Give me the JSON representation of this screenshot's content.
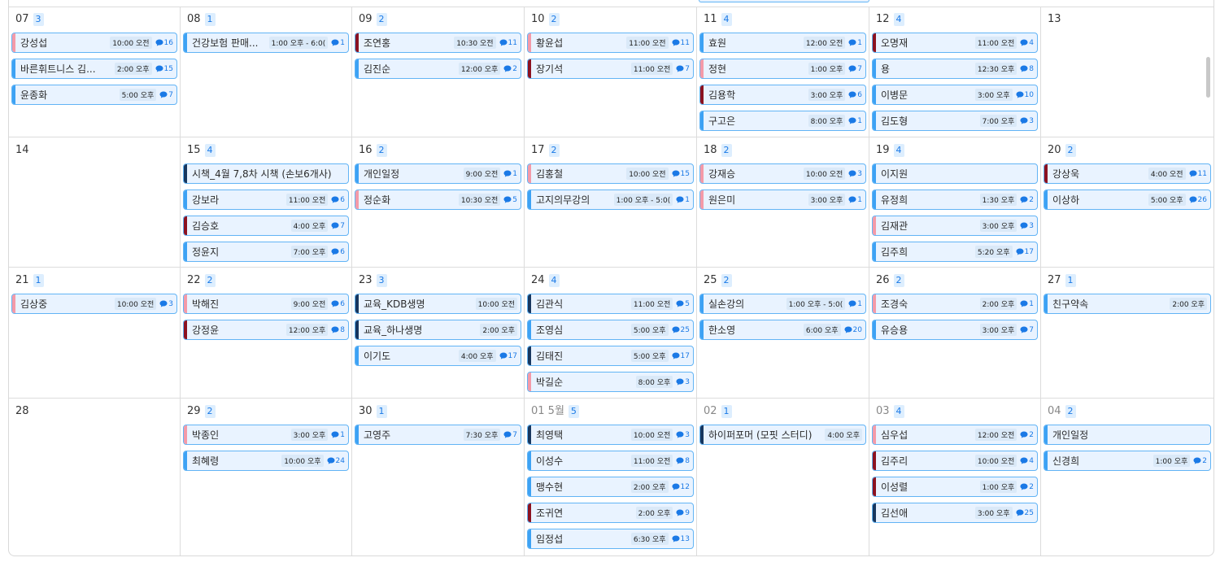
{
  "colors": {
    "pink": "#f49aa8",
    "red": "#8b1220",
    "navy": "#17375f",
    "blue": "#3da2f4"
  },
  "weeks": [
    [
      {
        "day": "07",
        "count": "3",
        "other": false,
        "events": [
          {
            "title": "강성섭",
            "time": "10:00 오전",
            "comments": "16",
            "color": "pink"
          },
          {
            "title": "바른휘트니스 김...",
            "time": "2:00 오후",
            "comments": "15",
            "color": "blue"
          },
          {
            "title": "윤종화",
            "time": "5:00 오후",
            "comments": "7",
            "color": "blue"
          }
        ]
      },
      {
        "day": "08",
        "count": "1",
        "other": false,
        "events": [
          {
            "title": "건강보험 판매...",
            "time": "1:00 오후 - 6:0(",
            "comments": "1",
            "color": "blue"
          }
        ]
      },
      {
        "day": "09",
        "count": "2",
        "other": false,
        "events": [
          {
            "title": "조연홍",
            "time": "10:30 오전",
            "comments": "11",
            "color": "red"
          },
          {
            "title": "김진순",
            "time": "12:00 오후",
            "comments": "2",
            "color": "blue"
          }
        ]
      },
      {
        "day": "10",
        "count": "2",
        "other": false,
        "events": [
          {
            "title": "황윤섭",
            "time": "11:00 오전",
            "comments": "11",
            "color": "pink"
          },
          {
            "title": "장기석",
            "time": "11:00 오전",
            "comments": "7",
            "color": "red"
          }
        ]
      },
      {
        "day": "11",
        "count": "4",
        "other": false,
        "events": [
          {
            "title": "효원",
            "time": "12:00 오전",
            "comments": "1",
            "color": "blue"
          },
          {
            "title": "정현",
            "time": "1:00 오후",
            "comments": "7",
            "color": "pink"
          },
          {
            "title": "김용학",
            "time": "3:00 오후",
            "comments": "6",
            "color": "red"
          },
          {
            "title": "구고은",
            "time": "8:00 오후",
            "comments": "1",
            "color": "blue"
          }
        ]
      },
      {
        "day": "12",
        "count": "4",
        "other": false,
        "events": [
          {
            "title": "오명재",
            "time": "11:00 오전",
            "comments": "4",
            "color": "red"
          },
          {
            "title": "용",
            "time": "12:30 오후",
            "comments": "8",
            "color": "blue"
          },
          {
            "title": "이병문",
            "time": "3:00 오후",
            "comments": "10",
            "color": "blue"
          },
          {
            "title": "김도형",
            "time": "7:00 오후",
            "comments": "3",
            "color": "blue"
          }
        ]
      },
      {
        "day": "13",
        "count": "",
        "other": false,
        "events": []
      }
    ],
    [
      {
        "day": "14",
        "count": "",
        "other": false,
        "events": []
      },
      {
        "day": "15",
        "count": "4",
        "other": false,
        "events": [
          {
            "title": "시책_4월 7,8차 시책 (손보6개사)",
            "time": "",
            "comments": "",
            "color": "navy"
          },
          {
            "title": "강보라",
            "time": "11:00 오전",
            "comments": "6",
            "color": "blue"
          },
          {
            "title": "김승호",
            "time": "4:00 오후",
            "comments": "7",
            "color": "red"
          },
          {
            "title": "정윤지",
            "time": "7:00 오후",
            "comments": "6",
            "color": "blue"
          }
        ]
      },
      {
        "day": "16",
        "count": "2",
        "other": false,
        "events": [
          {
            "title": "개인일정",
            "time": "9:00 오전",
            "comments": "1",
            "color": "blue"
          },
          {
            "title": "정순화",
            "time": "10:30 오전",
            "comments": "5",
            "color": "pink"
          }
        ]
      },
      {
        "day": "17",
        "count": "2",
        "other": false,
        "events": [
          {
            "title": "김홍철",
            "time": "10:00 오전",
            "comments": "15",
            "color": "pink"
          },
          {
            "title": "고지의무강의",
            "time": "1:00 오후 - 5:0(",
            "comments": "1",
            "color": "blue"
          }
        ]
      },
      {
        "day": "18",
        "count": "2",
        "other": false,
        "events": [
          {
            "title": "강재승",
            "time": "10:00 오전",
            "comments": "3",
            "color": "pink"
          },
          {
            "title": "원은미",
            "time": "3:00 오후",
            "comments": "1",
            "color": "pink"
          }
        ]
      },
      {
        "day": "19",
        "count": "4",
        "other": false,
        "events": [
          {
            "title": "이지원",
            "time": "",
            "comments": "",
            "color": "blue"
          },
          {
            "title": "유정희",
            "time": "1:30 오후",
            "comments": "2",
            "color": "blue"
          },
          {
            "title": "김재관",
            "time": "3:00 오후",
            "comments": "3",
            "color": "pink"
          },
          {
            "title": "김주희",
            "time": "5:20 오후",
            "comments": "17",
            "color": "blue"
          }
        ]
      },
      {
        "day": "20",
        "count": "2",
        "other": false,
        "events": [
          {
            "title": "강상욱",
            "time": "4:00 오전",
            "comments": "11",
            "color": "red"
          },
          {
            "title": "이상하",
            "time": "5:00 오후",
            "comments": "26",
            "color": "blue"
          }
        ]
      }
    ],
    [
      {
        "day": "21",
        "count": "1",
        "other": false,
        "events": [
          {
            "title": "김상중",
            "time": "10:00 오전",
            "comments": "3",
            "color": "pink"
          }
        ]
      },
      {
        "day": "22",
        "count": "2",
        "other": false,
        "events": [
          {
            "title": "박해진",
            "time": "9:00 오전",
            "comments": "6",
            "color": "pink"
          },
          {
            "title": "강정윤",
            "time": "12:00 오후",
            "comments": "8",
            "color": "red"
          }
        ]
      },
      {
        "day": "23",
        "count": "3",
        "other": false,
        "events": [
          {
            "title": "교육_KDB생명",
            "time": "10:00 오전",
            "comments": "",
            "color": "navy"
          },
          {
            "title": "교육_하나생명",
            "time": "2:00 오후",
            "comments": "",
            "color": "navy"
          },
          {
            "title": "이기도",
            "time": "4:00 오후",
            "comments": "17",
            "color": "blue"
          }
        ]
      },
      {
        "day": "24",
        "count": "4",
        "other": false,
        "events": [
          {
            "title": "김관식",
            "time": "11:00 오전",
            "comments": "5",
            "color": "navy"
          },
          {
            "title": "조영심",
            "time": "5:00 오후",
            "comments": "25",
            "color": "blue"
          },
          {
            "title": "김태진",
            "time": "5:00 오후",
            "comments": "17",
            "color": "navy"
          },
          {
            "title": "박길순",
            "time": "8:00 오후",
            "comments": "3",
            "color": "pink"
          }
        ]
      },
      {
        "day": "25",
        "count": "2",
        "other": false,
        "events": [
          {
            "title": "실손강의",
            "time": "1:00 오후 - 5:0(",
            "comments": "1",
            "color": "blue"
          },
          {
            "title": "한소영",
            "time": "6:00 오후",
            "comments": "20",
            "color": "blue"
          }
        ]
      },
      {
        "day": "26",
        "count": "2",
        "other": false,
        "events": [
          {
            "title": "조경숙",
            "time": "2:00 오후",
            "comments": "1",
            "color": "pink"
          },
          {
            "title": "유승용",
            "time": "3:00 오후",
            "comments": "7",
            "color": "blue"
          }
        ]
      },
      {
        "day": "27",
        "count": "1",
        "other": false,
        "events": [
          {
            "title": "친구약속",
            "time": "2:00 오후",
            "comments": "",
            "color": "blue"
          }
        ]
      }
    ],
    [
      {
        "day": "28",
        "count": "",
        "other": false,
        "events": []
      },
      {
        "day": "29",
        "count": "2",
        "other": false,
        "events": [
          {
            "title": "박종인",
            "time": "3:00 오후",
            "comments": "1",
            "color": "pink"
          },
          {
            "title": "최혜령",
            "time": "10:00 오후",
            "comments": "24",
            "color": "blue"
          }
        ]
      },
      {
        "day": "30",
        "count": "1",
        "other": false,
        "events": [
          {
            "title": "고영주",
            "time": "7:30 오후",
            "comments": "7",
            "color": "blue"
          }
        ]
      },
      {
        "day": "01 5월",
        "count": "5",
        "other": true,
        "events": [
          {
            "title": "최영택",
            "time": "10:00 오전",
            "comments": "3",
            "color": "navy"
          },
          {
            "title": "이성수",
            "time": "11:00 오전",
            "comments": "8",
            "color": "blue"
          },
          {
            "title": "맹수현",
            "time": "2:00 오후",
            "comments": "12",
            "color": "blue"
          },
          {
            "title": "조귀연",
            "time": "2:00 오후",
            "comments": "9",
            "color": "red"
          },
          {
            "title": "임정섭",
            "time": "6:30 오후",
            "comments": "13",
            "color": "blue"
          }
        ]
      },
      {
        "day": "02",
        "count": "1",
        "other": true,
        "events": [
          {
            "title": "하이퍼포머 (모핏 스터디)",
            "time": "4:00 오후",
            "comments": "",
            "color": "navy"
          }
        ]
      },
      {
        "day": "03",
        "count": "4",
        "other": true,
        "events": [
          {
            "title": "심우섭",
            "time": "12:00 오전",
            "comments": "2",
            "color": "pink"
          },
          {
            "title": "김주리",
            "time": "10:00 오전",
            "comments": "4",
            "color": "red"
          },
          {
            "title": "이성렬",
            "time": "1:00 오후",
            "comments": "2",
            "color": "red"
          },
          {
            "title": "김선애",
            "time": "3:00 오후",
            "comments": "25",
            "color": "navy"
          }
        ]
      },
      {
        "day": "04",
        "count": "2",
        "other": true,
        "events": [
          {
            "title": "개인일정",
            "time": "",
            "comments": "",
            "color": "blue"
          },
          {
            "title": "신경희",
            "time": "1:00 오후",
            "comments": "2",
            "color": "blue"
          }
        ]
      }
    ]
  ]
}
